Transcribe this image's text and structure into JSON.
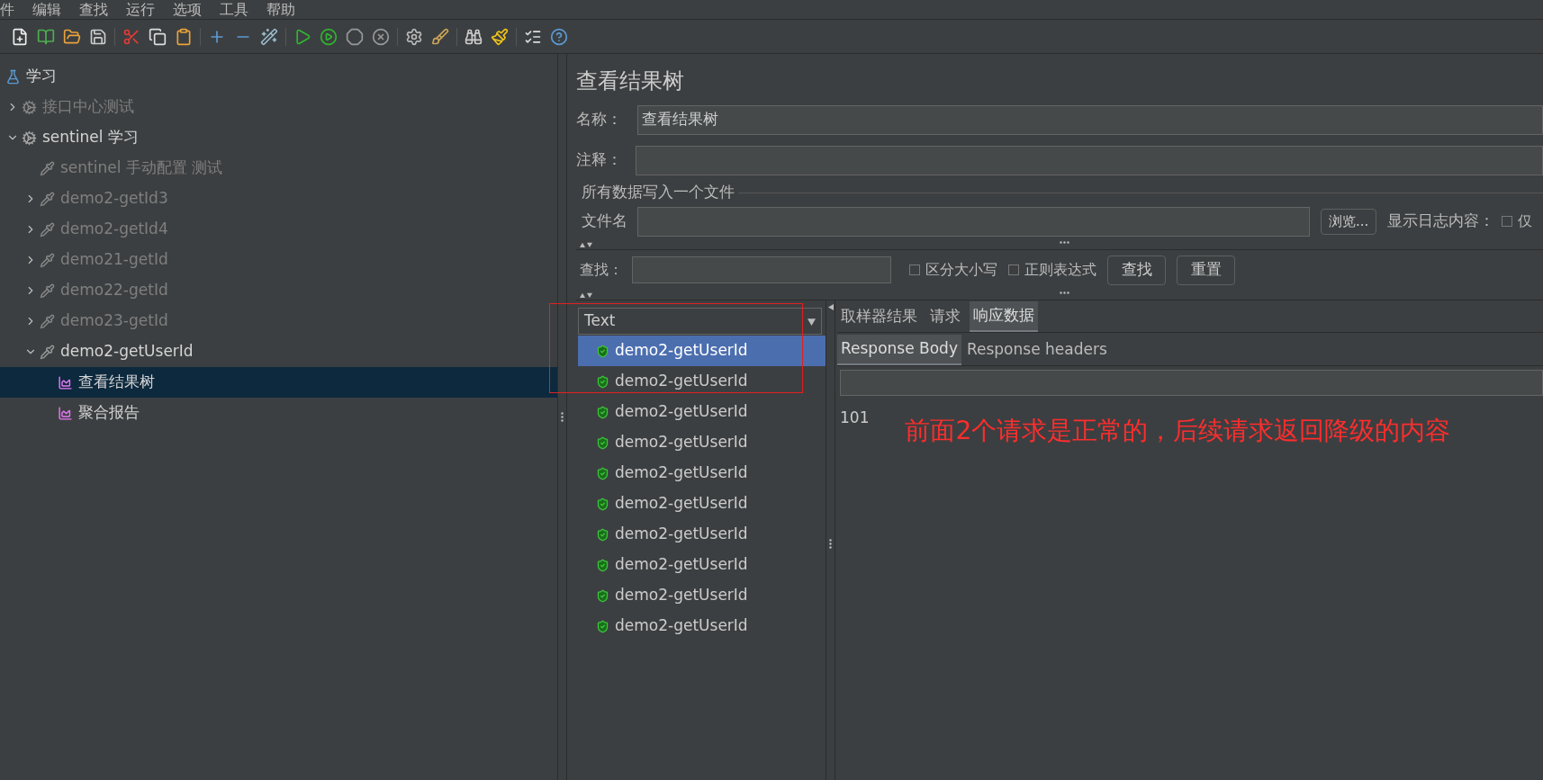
{
  "menu": [
    "件",
    "编辑",
    "查找",
    "运行",
    "选项",
    "工具",
    "帮助"
  ],
  "tree": {
    "label": "学习",
    "kind": "flask",
    "enabled": true,
    "selected": false,
    "children": [
      {
        "label": "接口中心测试",
        "kind": "gear",
        "enabled": false,
        "selected": false,
        "expanded": false
      },
      {
        "label": "sentinel 学习",
        "kind": "gear",
        "enabled": true,
        "selected": false,
        "expanded": true,
        "children": [
          {
            "label": "sentinel 手动配置 测试",
            "kind": "sampler",
            "enabled": false,
            "selected": false
          },
          {
            "label": "demo2-getId3",
            "kind": "sampler",
            "enabled": false,
            "selected": false,
            "expanded": false
          },
          {
            "label": "demo2-getId4",
            "kind": "sampler",
            "enabled": false,
            "selected": false,
            "expanded": false
          },
          {
            "label": "demo21-getId",
            "kind": "sampler",
            "enabled": false,
            "selected": false,
            "expanded": false
          },
          {
            "label": "demo22-getId",
            "kind": "sampler",
            "enabled": false,
            "selected": false,
            "expanded": false
          },
          {
            "label": "demo23-getId",
            "kind": "sampler",
            "enabled": false,
            "selected": false,
            "expanded": false
          },
          {
            "label": "demo2-getUserId",
            "kind": "sampler",
            "enabled": true,
            "selected": false,
            "expanded": true,
            "children": [
              {
                "label": "查看结果树",
                "kind": "listener",
                "enabled": true,
                "selected": true
              },
              {
                "label": "聚合报告",
                "kind": "listener",
                "enabled": true,
                "selected": false
              }
            ]
          }
        ]
      }
    ]
  },
  "panel": {
    "title": "查看结果树",
    "name": {
      "label": "名称：",
      "value": "查看结果树"
    },
    "comment": {
      "label": "注释："
    },
    "file_group": {
      "title": "所有数据写入一个文件",
      "file_label": "文件名",
      "browse": "浏览...",
      "log_label": "显示日志内容：",
      "only": {
        "label": "仅",
        "checked": false
      }
    },
    "search": {
      "label": "查找：",
      "options": [
        {
          "label": "区分大小写",
          "checked": false
        },
        {
          "label": "正则表达式",
          "checked": false
        }
      ],
      "buttons": [
        "查找",
        "重置"
      ]
    },
    "renderer": "Text",
    "results": [
      {
        "label": "demo2-getUserId",
        "selected": true
      },
      {
        "label": "demo2-getUserId",
        "selected": false
      },
      {
        "label": "demo2-getUserId",
        "selected": false
      },
      {
        "label": "demo2-getUserId",
        "selected": false
      },
      {
        "label": "demo2-getUserId",
        "selected": false
      },
      {
        "label": "demo2-getUserId",
        "selected": false
      },
      {
        "label": "demo2-getUserId",
        "selected": false
      },
      {
        "label": "demo2-getUserId",
        "selected": false
      },
      {
        "label": "demo2-getUserId",
        "selected": false
      },
      {
        "label": "demo2-getUserId",
        "selected": false
      }
    ],
    "tabs": [
      {
        "label": "取样器结果",
        "selected": false
      },
      {
        "label": "请求",
        "selected": false
      },
      {
        "label": "响应数据",
        "selected": true
      }
    ],
    "subtabs": [
      {
        "label": "Response Body",
        "selected": true
      },
      {
        "label": "Response headers",
        "selected": false
      }
    ],
    "body": "101",
    "annotation": "前面2个请求是正常的，后续请求返回降级的内容"
  }
}
